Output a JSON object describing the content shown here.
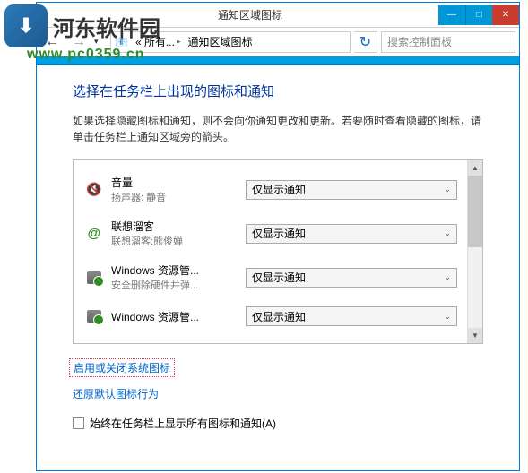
{
  "watermark": {
    "logo": "河东软件园",
    "url": "www.pc0359.cn"
  },
  "window": {
    "title": "通知区域图标",
    "buttons": {
      "min": "—",
      "max": "□",
      "close": "✕"
    }
  },
  "toolbar": {
    "back_glyph": "←",
    "fwd_glyph": "→",
    "dd_glyph": "▾",
    "breadcrumb": {
      "icon": "📧",
      "seg1": "« 所有...",
      "seg2": "通知区域图标",
      "sep": "▸"
    },
    "refresh_glyph": "↻",
    "search_placeholder": "搜索控制面板"
  },
  "content": {
    "heading": "选择在任务栏上出现的图标和通知",
    "description": "如果选择隐藏图标和通知，则不会向你通知更改和更新。若要随时查看隐藏的图标，请单击任务栏上通知区域旁的箭头。",
    "rows": [
      {
        "title": "音量",
        "sub": "扬声器: 静音",
        "select": "仅显示通知",
        "icon": "speaker"
      },
      {
        "title": "联想溜客",
        "sub": "联想溜客:熊俊婵",
        "select": "仅显示通知",
        "icon": "at"
      },
      {
        "title": "Windows 资源管...",
        "sub": "安全删除硬件并弹...",
        "select": "仅显示通知",
        "icon": "usb"
      },
      {
        "title": "Windows 资源管...",
        "sub": "",
        "select": "仅显示通知",
        "icon": "usb"
      }
    ],
    "link1": "启用或关闭系统图标",
    "link2": "还原默认图标行为",
    "checkbox_label": "始终在任务栏上显示所有图标和通知(A)"
  },
  "scrollbar": {
    "up": "▲",
    "down": "▼"
  }
}
